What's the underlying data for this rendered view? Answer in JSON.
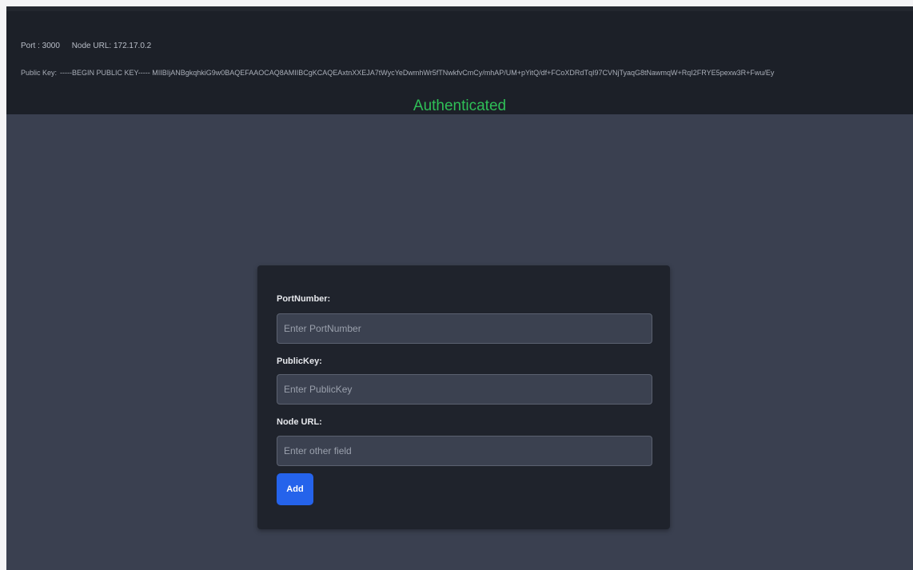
{
  "header": {
    "port_text": "Port : 3000",
    "node_url_text": "Node URL: 172.17.0.2",
    "public_key_label": "Public Key:",
    "public_key_value": "-----BEGIN PUBLIC KEY----- MIIBIjANBgkqhkiG9w0BAQEFAAOCAQ8AMIIBCgKCAQEAxtnXXEJA7tWycYeDwmhWr5fTNwkfvCmCy/mhAP/UM+pYitQ/df+FCoXDRdTqI97CVNjTyaqG8tNawmqW+RqI2FRYE5pexw3R+Fwu/Ey",
    "status": "Authenticated"
  },
  "colors": {
    "status": "#2fbf57",
    "button": "#2563eb",
    "background": "#3a4050",
    "header_background": "#1c2028",
    "card_background": "#1f232c"
  },
  "form": {
    "port": {
      "label": "PortNumber:",
      "placeholder": "Enter PortNumber",
      "value": ""
    },
    "public_key": {
      "label": "PublicKey:",
      "placeholder": "Enter PublicKey",
      "value": ""
    },
    "node_url": {
      "label": "Node URL:",
      "placeholder": "Enter other field",
      "value": ""
    },
    "add_label": "Add"
  }
}
